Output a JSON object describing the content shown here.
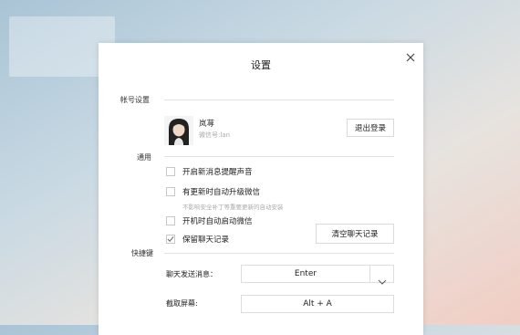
{
  "dialog": {
    "title": "设置",
    "close_icon": "close-icon"
  },
  "account": {
    "section_label": "帐号设置",
    "name": "岚荨",
    "wechat_id": "微信号:lan",
    "logout_label": "退出登录"
  },
  "general": {
    "section_label": "通用",
    "options": [
      {
        "label": "开启新消息提醒声音",
        "checked": false
      },
      {
        "label": "有更新时自动升级微信",
        "checked": false
      },
      {
        "label": "开机时自动启动微信",
        "checked": false
      },
      {
        "label": "保留聊天记录",
        "checked": true
      }
    ],
    "update_hint": "不影响安全补丁等重要更新的自动安装",
    "clear_history_label": "清空聊天记录"
  },
  "shortcuts": {
    "section_label": "快捷键",
    "send_label": "聊天发送消息：",
    "send_value": "Enter",
    "screenshot_label": "截取屏幕:",
    "screenshot_value": "Alt + A"
  }
}
